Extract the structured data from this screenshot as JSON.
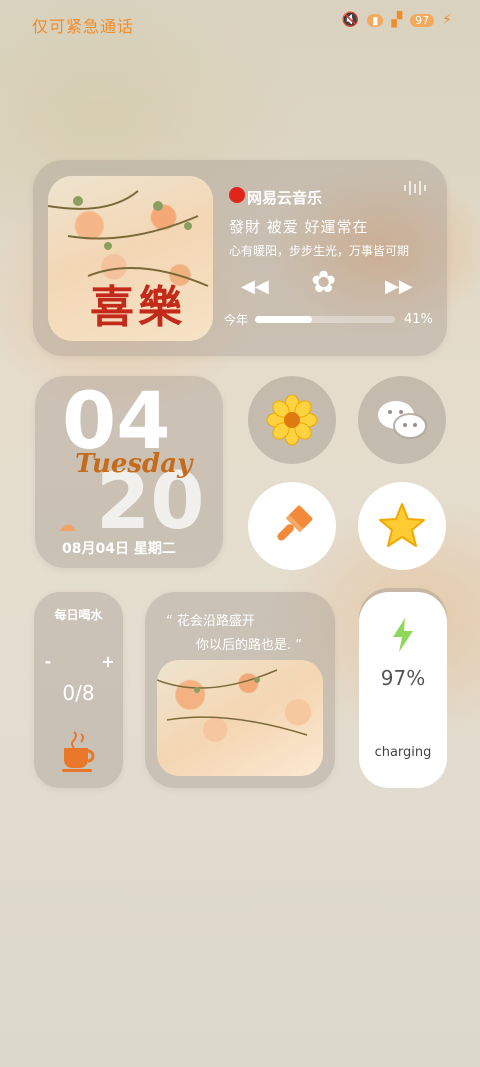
{
  "status_bar": {
    "left_text": "仅可紧急通话",
    "battery_level": "97"
  },
  "music": {
    "app_name": "网易云音乐",
    "song": "發財 被爱 好運常在",
    "lyric": "心有暖阳，步步生光，万事皆可期",
    "progress_label": "今年",
    "progress_percent": "41%",
    "progress_value": 0.41,
    "cover_text": "喜樂"
  },
  "date_widget": {
    "day": "04",
    "month_big": "20",
    "weekday": "Tuesday",
    "date_line": "08月04日  星期二"
  },
  "water_widget": {
    "title": "每日喝水",
    "minus": "-",
    "plus": "+",
    "count": "0/8"
  },
  "quote_widget": {
    "line1": "“ 花会沿路盛开",
    "line2": "你以后的路也是. ”"
  },
  "battery_widget": {
    "percent": "97%",
    "status": "charging"
  },
  "colors": {
    "accent_orange": "#f08c2a",
    "weekday_brown": "#c66b1c",
    "battery_green": "#8fd85b"
  }
}
